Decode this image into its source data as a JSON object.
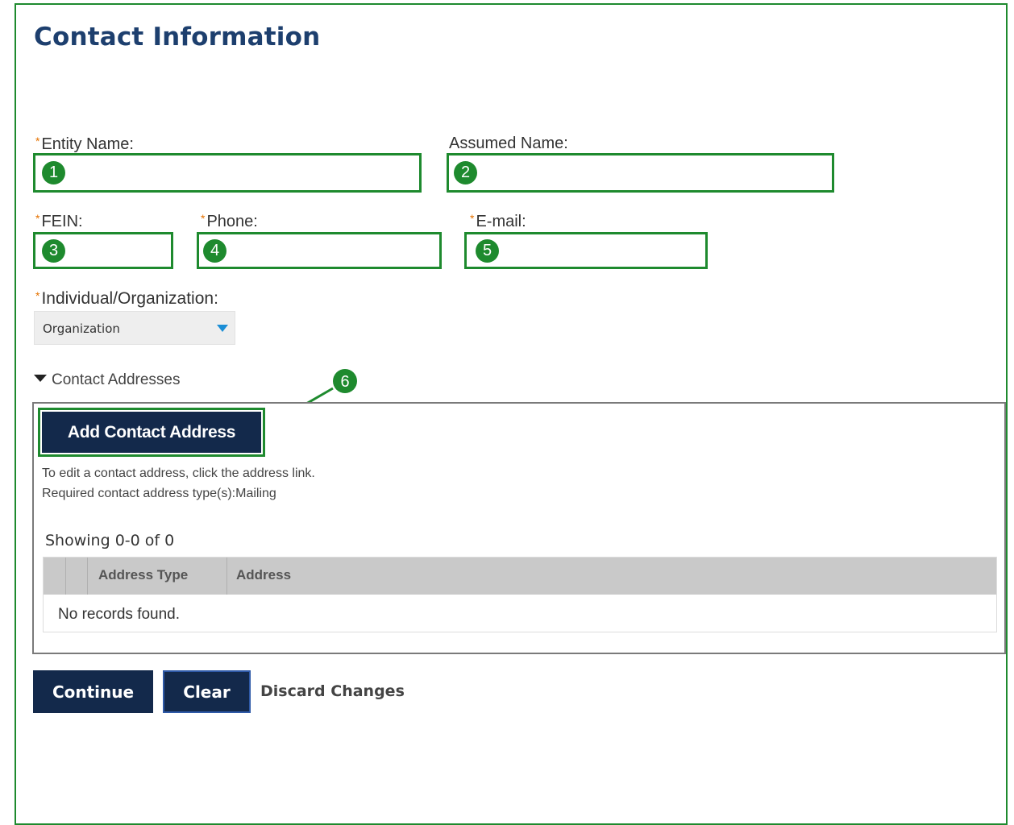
{
  "page": {
    "title": "Contact Information"
  },
  "form": {
    "entity_name": {
      "label": "Entity Name:",
      "required_mark": "*",
      "value": "",
      "marker": "1"
    },
    "assumed_name": {
      "label": "Assumed Name:",
      "value": "",
      "marker": "2"
    },
    "fein": {
      "label": "FEIN:",
      "required_mark": "*",
      "value": "",
      "marker": "3"
    },
    "phone": {
      "label": "Phone:",
      "required_mark": "*",
      "value": "",
      "marker": "4"
    },
    "email": {
      "label": "E-mail:",
      "required_mark": "*",
      "value": "",
      "marker": "5"
    },
    "individual_org": {
      "label": "Individual/Organization:",
      "required_mark": "*",
      "selected": "Organization",
      "caret_icon": "chevron-down-icon"
    }
  },
  "contact_addresses": {
    "section_label": "Contact Addresses",
    "toggle_icon": "caret-down-icon",
    "marker": "6",
    "add_button": "Add Contact Address",
    "help_line_1": "To edit a contact address, click the address link.",
    "help_line_2": "Required contact address type(s):Mailing",
    "showing": "Showing 0-0 of 0",
    "columns": [
      "Address Type",
      "Address"
    ],
    "empty_message": "No records found."
  },
  "actions": {
    "continue": "Continue",
    "clear": "Clear",
    "discard": "Discard Changes"
  },
  "colors": {
    "annotation_green": "#1e8a2e",
    "title_blue": "#1d3f6e",
    "button_navy": "#13294b",
    "required_orange": "#e57200",
    "dropdown_caret": "#1b8ed6"
  }
}
